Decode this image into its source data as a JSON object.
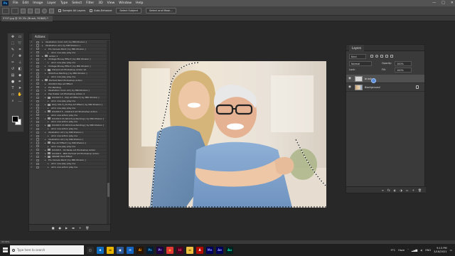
{
  "app": {
    "logo": "Ps"
  },
  "menubar": {
    "items": [
      "File",
      "Edit",
      "Image",
      "Layer",
      "Type",
      "Select",
      "Filter",
      "3D",
      "View",
      "Window",
      "Help"
    ],
    "controls": [
      "—",
      "□",
      "✕"
    ]
  },
  "options": {
    "sample_all": "Sample All Layers",
    "auto_enhance": "Auto-Enhance",
    "select_subject": "Select Subject",
    "select_mask": "Select and Mask..."
  },
  "document": {
    "tab": "5707.jpg @ 33.3% (Brush, RGB/8) *",
    "status": "33.33%"
  },
  "actions_panel": {
    "title": "Actions",
    "rows": [
      {
        "check": "✓",
        "indent": 0,
        "type": "action",
        "label": "Illustration Color Art [ by MRI Khokon ]"
      },
      {
        "check": "✓",
        "indent": 0,
        "type": "action",
        "label": "Illustration Art [ by MRI Khokon ]"
      },
      {
        "check": "✓",
        "indent": 1,
        "type": "action",
        "label": "Pro Canvas Paint [ by MRI Khokon ]"
      },
      {
        "check": "✓",
        "indent": 2,
        "type": "action",
        "label": "all in one play play me"
      },
      {
        "check": "✓",
        "indent": 0,
        "type": "folder",
        "label": "Action 1"
      },
      {
        "check": "✓",
        "indent": 1,
        "type": "action",
        "label": "Vintage Money Effect [ by MRI Khokon ]"
      },
      {
        "check": "✓",
        "indent": 2,
        "type": "action",
        "label": "all in one play play me"
      },
      {
        "check": "✓",
        "indent": 1,
        "type": "action",
        "label": "Vintage Money Effect [ by MRI Khokon ]"
      },
      {
        "check": "✓",
        "indent": 1,
        "type": "folder",
        "label": "Vibrant Art Photoshop Action 10"
      },
      {
        "check": "✓",
        "indent": 1,
        "type": "action",
        "label": "Wickrhua Painting [ by MRI Khokon ]"
      },
      {
        "check": "✓",
        "indent": 2,
        "type": "action",
        "label": "all in one play play me"
      },
      {
        "check": "✓",
        "indent": 0,
        "type": "folder",
        "label": "Portrait Paint Photoshop Action"
      },
      {
        "check": "✓",
        "indent": 1,
        "type": "action",
        "label": "ICC2013 Pop Art Effect"
      },
      {
        "check": "✓",
        "indent": 1,
        "type": "action",
        "label": "Pro Painting"
      },
      {
        "check": "✓",
        "indent": 1,
        "type": "action",
        "label": "Illustration Color Art [ by MRI Khokon ]"
      },
      {
        "check": "✓",
        "indent": 1,
        "type": "action",
        "label": "Pop Poster Art Photoshop Action 4"
      },
      {
        "check": "✓",
        "indent": 1,
        "type": "folder",
        "label": "ICC2015 1 - Pop Art Effect [ by MRI Khokon ]"
      },
      {
        "check": "✓",
        "indent": 2,
        "type": "action",
        "label": "all in one play play me"
      },
      {
        "check": "✓",
        "indent": 1,
        "type": "folder",
        "label": "Only CS1.5_CS Pop Art Effect [ by MRI Khokon ]"
      },
      {
        "check": "✓",
        "indent": 2,
        "type": "action",
        "label": "all in one play play me"
      },
      {
        "check": "✓",
        "indent": 1,
        "type": "folder",
        "label": "ICC2015 5 - Abstract Art Photoshop Action"
      },
      {
        "check": "✓",
        "indent": 2,
        "type": "action",
        "label": "all in one action play me"
      },
      {
        "check": "✓",
        "indent": 1,
        "type": "folder",
        "label": "ICC2015 CS Wickrhua Painting [ by MRI Khokon ]"
      },
      {
        "check": "✓",
        "indent": 2,
        "type": "action",
        "label": "all in one action play me"
      },
      {
        "check": "✓",
        "indent": 1,
        "type": "folder",
        "label": "ICC2015 CS Wickrhua Painting [ by MRI Khokon ]"
      },
      {
        "check": "✓",
        "indent": 2,
        "type": "action",
        "label": "all in one action play me"
      },
      {
        "check": "✓",
        "indent": 1,
        "type": "action",
        "label": "Illustration Art [ by MRI Khokon ]"
      },
      {
        "check": "✓",
        "indent": 2,
        "type": "action",
        "label": "all in one action play me"
      },
      {
        "check": "✓",
        "indent": 1,
        "type": "action",
        "label": "Illustration Art [ by MRI Khokon ]"
      },
      {
        "check": "✓",
        "indent": 1,
        "type": "folder",
        "label": "Pop Art Effect [ by MRI Khokon ]"
      },
      {
        "check": "✓",
        "indent": 2,
        "type": "action",
        "label": "all in one play play me"
      },
      {
        "check": "✓",
        "indent": 1,
        "type": "folder",
        "label": "ICC2015 - Oil Paste Art Photoshop Action"
      },
      {
        "check": "✓",
        "indent": 1,
        "type": "folder",
        "label": "ICC2015 - PRO Portrait Art Photoshop Action"
      },
      {
        "check": "✓",
        "indent": 1,
        "type": "folder",
        "label": "SMORE Hard Effect"
      },
      {
        "check": "✓",
        "indent": 1,
        "type": "action",
        "label": "Pro Canvas Paint [ by MRI Khokon ]"
      },
      {
        "check": "✓",
        "indent": 2,
        "type": "action",
        "label": "all in one play play me"
      },
      {
        "check": "✓",
        "indent": 2,
        "type": "action",
        "label": "all in one action play me"
      }
    ],
    "footer": [
      "■",
      "●",
      "▶",
      "▬",
      "+",
      "🗑"
    ]
  },
  "layers_panel": {
    "title": "Layers",
    "kind_label": "Kind",
    "blend_mode": "Normal",
    "opacity_label": "Opacity:",
    "opacity_value": "100%",
    "lock_label": "Lock:",
    "fill_label": "Fill:",
    "fill_value": "100%",
    "layers": [
      {
        "name": "brush",
        "active": true,
        "thumb": "checker",
        "italic": false
      },
      {
        "name": "Background",
        "active": false,
        "thumb": "photo",
        "italic": true
      }
    ],
    "footer": [
      "∞",
      "fx",
      "◐",
      "◑",
      "▭",
      "+",
      "🗑"
    ]
  },
  "taskbar": {
    "search_placeholder": "Type here to search",
    "apps": [
      {
        "name": "task-view-icon",
        "glyph": "◫",
        "color": "#2a2a2a",
        "fg": "#ddd"
      },
      {
        "name": "edge-icon",
        "glyph": "e",
        "color": "#0f6cbd",
        "fg": "#fff"
      },
      {
        "name": "explorer-icon",
        "glyph": "▬",
        "color": "#e8b400",
        "fg": "#5a3d00"
      },
      {
        "name": "store-icon",
        "glyph": "▣",
        "color": "#2b5797",
        "fg": "#fff"
      },
      {
        "name": "mail-icon",
        "glyph": "✉",
        "color": "#1565c0",
        "fg": "#fff"
      },
      {
        "name": "illustrator-icon",
        "glyph": "Ai",
        "color": "#2a1600",
        "fg": "#ff9a00"
      },
      {
        "name": "photoshop-icon",
        "glyph": "Ps",
        "color": "#001e36",
        "fg": "#31a8ff"
      },
      {
        "name": "premiere-icon",
        "glyph": "Pr",
        "color": "#1f0040",
        "fg": "#9999ff"
      },
      {
        "name": "chrome-icon",
        "glyph": "◉",
        "color": "#e53935",
        "fg": "#fbc02d"
      },
      {
        "name": "indesign-icon",
        "glyph": "Id",
        "color": "#49021f",
        "fg": "#ff3366"
      },
      {
        "name": "folder-icon",
        "glyph": "▬",
        "color": "#f0c040",
        "fg": "#7a5a00"
      },
      {
        "name": "acrobat-icon",
        "glyph": "A",
        "color": "#b30b00",
        "fg": "#fff"
      },
      {
        "name": "media-encoder-icon",
        "glyph": "Me",
        "color": "#00005b",
        "fg": "#8c8cff"
      },
      {
        "name": "after-effects-icon",
        "glyph": "Ae",
        "color": "#00005b",
        "fg": "#9999ff"
      },
      {
        "name": "audition-icon",
        "glyph": "Au",
        "color": "#00221e",
        "fg": "#00e4bb"
      }
    ],
    "weather": "9°C",
    "weather_label": "Haze",
    "language": "ENG",
    "time": "9:13 PM",
    "date": "3/16/2021"
  },
  "colors": {
    "accent": "#31a8ff",
    "panel": "#3a3a3a",
    "workspace": "#282828"
  }
}
